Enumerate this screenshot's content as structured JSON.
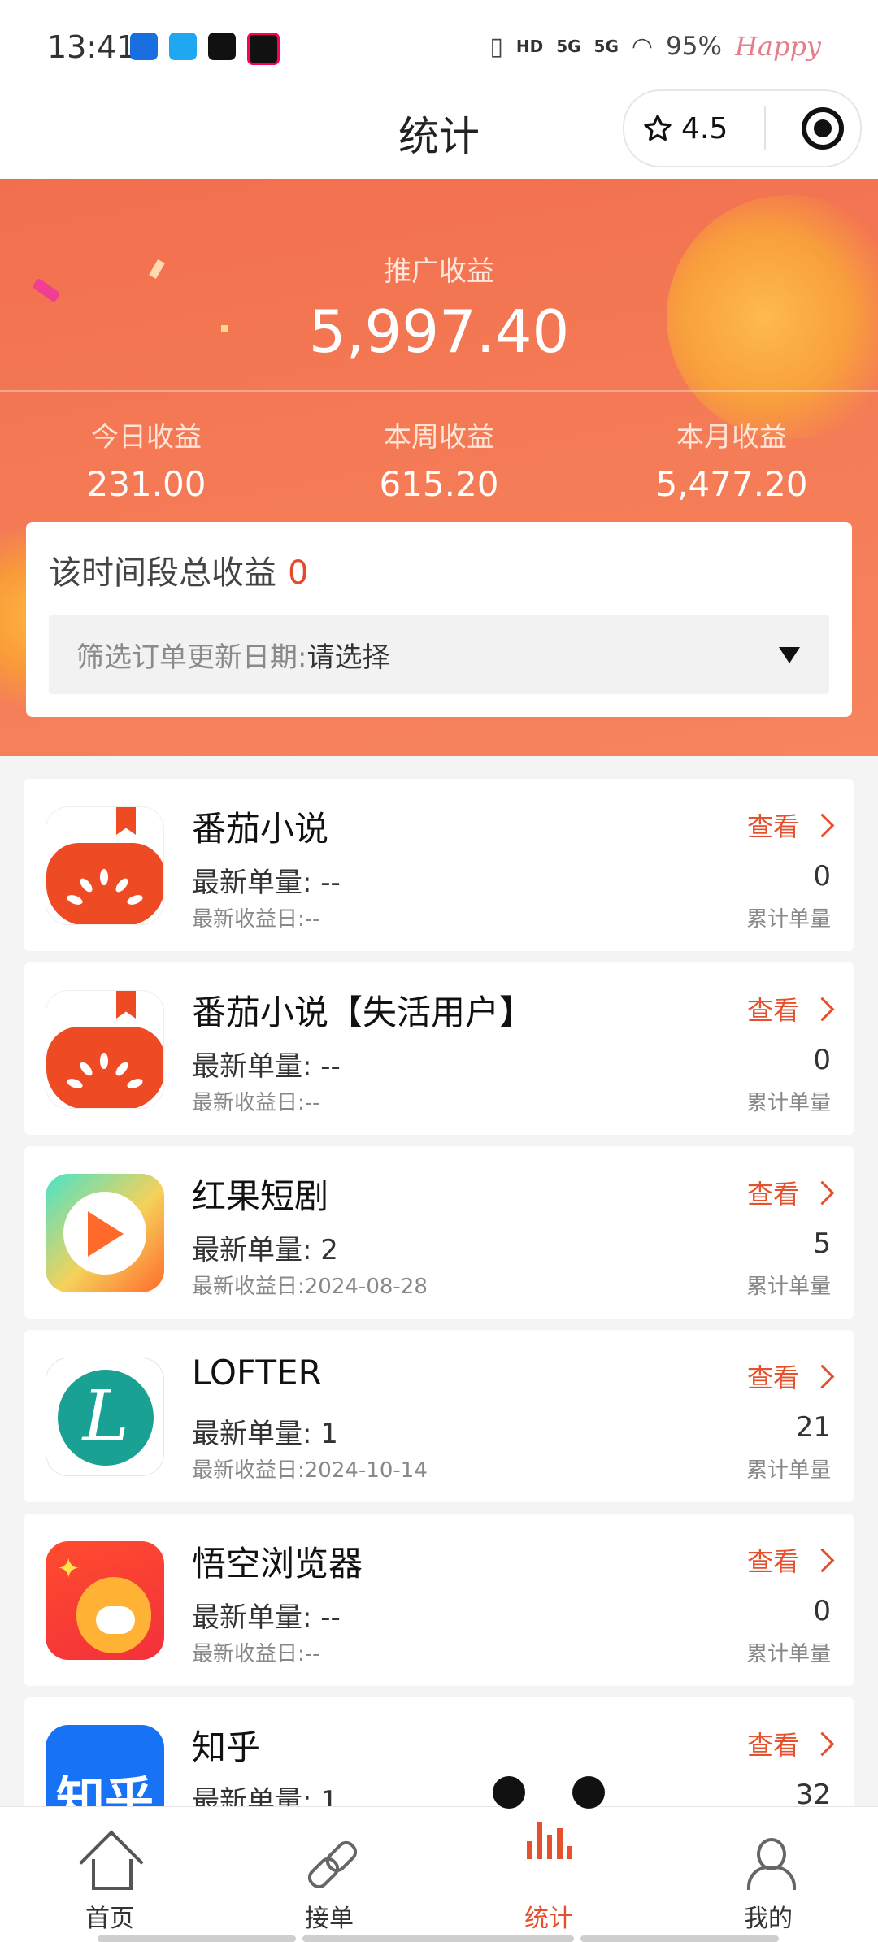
{
  "status_bar": {
    "time": "13:41",
    "signal_1": "5G",
    "signal_2": "5G",
    "battery": "95%",
    "theme_label": "Happy",
    "app_icons": [
      "assistant-icon",
      "qq-icon",
      "douyin-icon",
      "douyin-lite-icon"
    ]
  },
  "header": {
    "title": "统计",
    "rating": "4.5",
    "rating_icon": "star-icon",
    "menu_icon": "target-icon"
  },
  "summary": {
    "total_label": "推广收益",
    "total_value": "5,997.40",
    "periods": [
      {
        "label": "今日收益",
        "value": "231.00"
      },
      {
        "label": "本周收益",
        "value": "615.20"
      },
      {
        "label": "本月收益",
        "value": "5,477.20"
      }
    ]
  },
  "filter": {
    "range_label": "该时间段总收益",
    "range_value": "0",
    "date_label": "筛选订单更新日期:",
    "date_value": "请选择"
  },
  "list": {
    "view_label": "查看",
    "latest_count_label": "最新单量:",
    "latest_date_label": "最新收益日:",
    "total_count_label": "累计单量",
    "items": [
      {
        "name": "番茄小说",
        "latest_count": "--",
        "latest_date": "--",
        "total_count": "0",
        "icon": "fanqie-novel-icon"
      },
      {
        "name": "番茄小说【失活用户】",
        "latest_count": "--",
        "latest_date": "--",
        "total_count": "0",
        "icon": "fanqie-novel-icon"
      },
      {
        "name": "红果短剧",
        "latest_count": "2",
        "latest_date": "2024-08-28",
        "total_count": "5",
        "icon": "hongguo-drama-icon"
      },
      {
        "name": "LOFTER",
        "latest_count": "1",
        "latest_date": "2024-10-14",
        "total_count": "21",
        "icon": "lofter-icon"
      },
      {
        "name": "悟空浏览器",
        "latest_count": "--",
        "latest_date": "--",
        "total_count": "0",
        "icon": "wukong-browser-icon"
      },
      {
        "name": "知乎",
        "latest_count": "1",
        "latest_date": "",
        "total_count": "32",
        "icon": "zhihu-icon"
      }
    ]
  },
  "tabbar": {
    "tabs": [
      {
        "label": "首页",
        "icon": "home-icon"
      },
      {
        "label": "接单",
        "icon": "link-icon"
      },
      {
        "label": "统计",
        "icon": "bar-chart-icon",
        "active": true
      },
      {
        "label": "我的",
        "icon": "user-icon"
      }
    ]
  },
  "colors": {
    "accent": "#e4512c",
    "hero_bg": "#f47a55",
    "zero_value": "#e44a2b"
  }
}
